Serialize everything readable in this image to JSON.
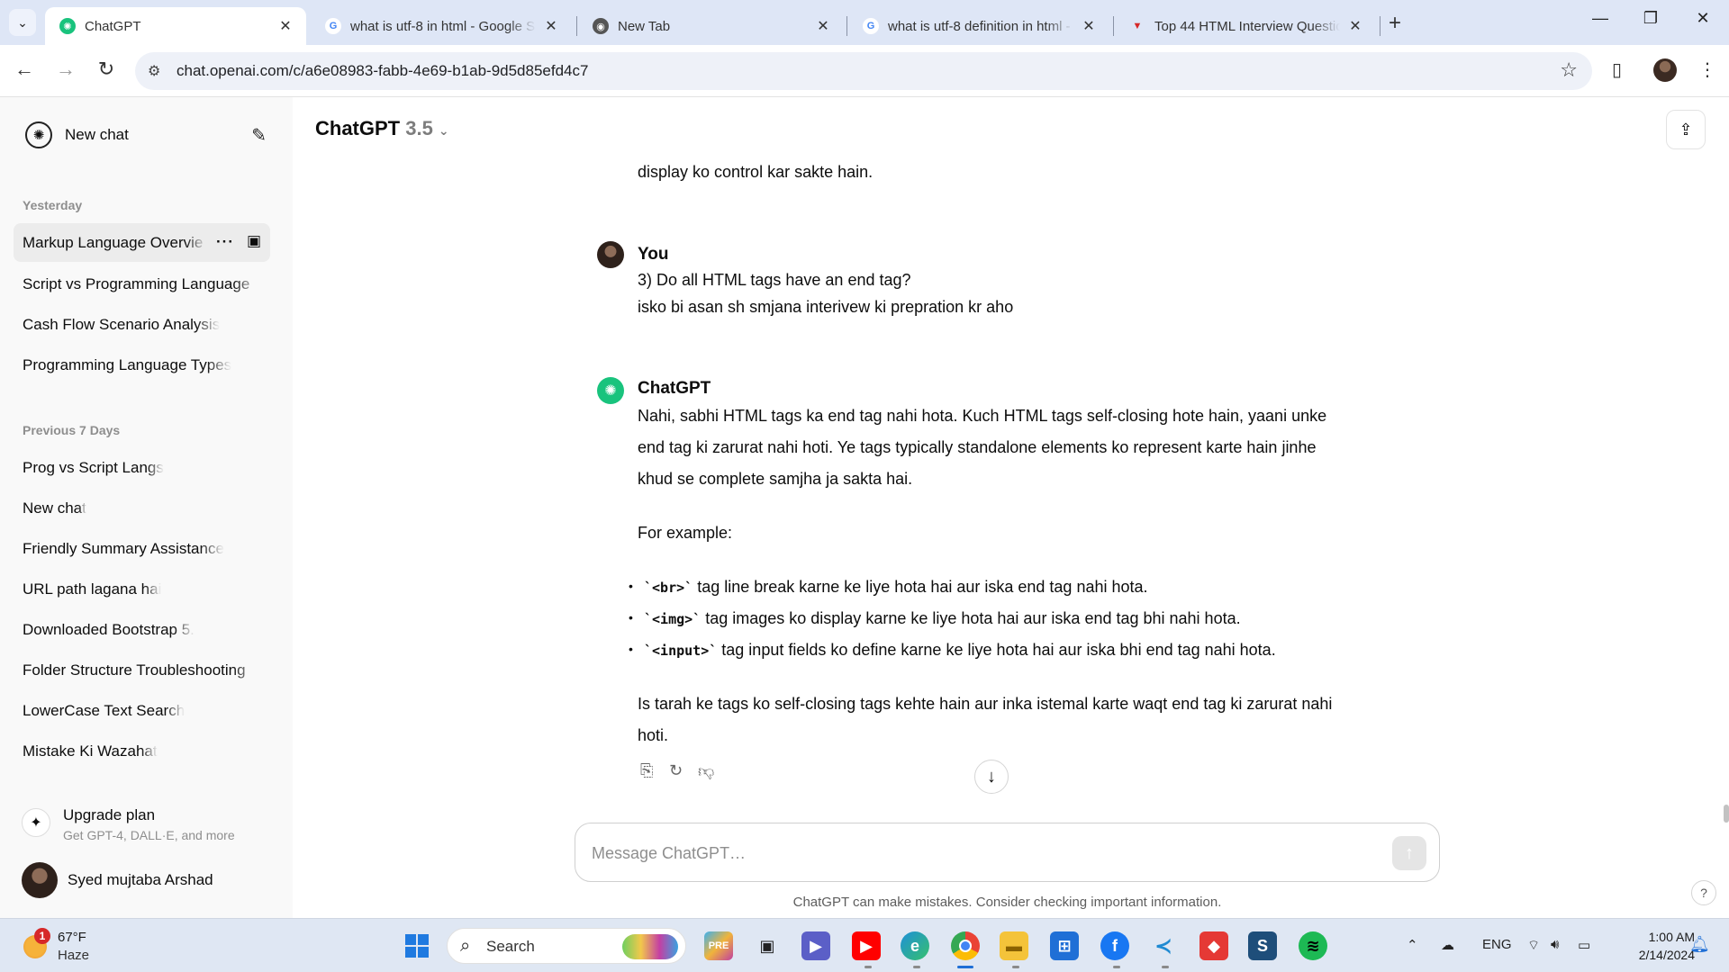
{
  "browser": {
    "tabs": [
      {
        "title": "ChatGPT",
        "active": true
      },
      {
        "title": "what is utf-8 in html - Google S",
        "active": false
      },
      {
        "title": "New Tab",
        "active": false
      },
      {
        "title": "what is utf-8 definition in html -",
        "active": false
      },
      {
        "title": "Top 44 HTML Interview Questio",
        "active": false
      }
    ],
    "url": "chat.openai.com/c/a6e08983-fabb-4e69-b1ab-9d5d85efd4c7"
  },
  "sidebar": {
    "new_chat_label": "New chat",
    "sections": [
      {
        "heading": "Yesterday",
        "items": [
          "Markup Language Overvie",
          "Script vs Programming Language",
          "Cash Flow Scenario Analysis",
          "Programming Language Types"
        ]
      },
      {
        "heading": "Previous 7 Days",
        "items": [
          "Prog vs Script Langs",
          "New chat",
          "Friendly Summary Assistance",
          "URL path lagana hai",
          "Downloaded Bootstrap 5.",
          "Folder Structure Troubleshooting",
          "LowerCase Text Search",
          "Mistake Ki Wazahat"
        ]
      }
    ],
    "upgrade": {
      "title": "Upgrade plan",
      "subtitle": "Get GPT-4, DALL·E, and more"
    },
    "user_name": "Syed mujtaba Arshad"
  },
  "header": {
    "model_name": "ChatGPT",
    "model_version": "3.5"
  },
  "conversation": {
    "prev_tail": "display ko control kar sakte hain.",
    "user": {
      "author": "You",
      "lines": [
        "3) Do all HTML tags have an end tag?",
        "isko bi asan sh smjana interivew ki prepration kr aho"
      ]
    },
    "assistant": {
      "author": "ChatGPT",
      "intro_lines": [
        "Nahi, sabhi HTML tags ka end tag nahi hota. Kuch HTML tags self-closing hote hain, yaani unke",
        "end tag ki zarurat nahi hoti. Ye tags typically standalone elements ko represent karte hain jinhe",
        "khud se complete samjha ja sakta hai."
      ],
      "example_heading": "For example:",
      "bullets": [
        {
          "code": "`<br>`",
          "text": " tag line break karne ke liye hota hai aur iska end tag nahi hota."
        },
        {
          "code": "`<img>`",
          "text": " tag images ko display karne ke liye hota hai aur iska end tag bhi nahi hota."
        },
        {
          "code": "`<input>`",
          "text": " tag input fields ko define karne ke liye hota hai aur iska bhi end tag nahi hota."
        }
      ],
      "outro_lines": [
        "Is tarah ke tags ko self-closing tags kehte hain aur inka istemal karte waqt end tag ki zarurat nahi",
        "hoti."
      ]
    }
  },
  "composer": {
    "placeholder": "Message ChatGPT…",
    "disclaimer": "ChatGPT can make mistakes. Consider checking important information."
  },
  "taskbar": {
    "weather_temp": "67°F",
    "weather_cond": "Haze",
    "weather_badge": "1",
    "search_label": "Search",
    "language": "ENG",
    "time": "1:00 AM",
    "date": "2/14/2024"
  },
  "colors": {
    "accent": "#19c37d",
    "sidebar_bg": "#f9f9f9",
    "tabstrip_bg": "#dee6f6",
    "taskbar_bg": "#dfe7f3"
  }
}
